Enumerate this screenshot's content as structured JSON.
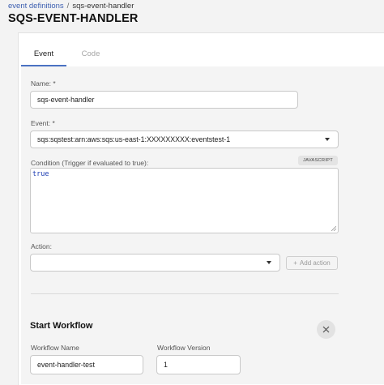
{
  "breadcrumb": {
    "link": "event definitions",
    "separator": "/",
    "current": "sqs-event-handler"
  },
  "page": {
    "title": "SQS-EVENT-HANDLER"
  },
  "tabs": [
    {
      "label": "Event",
      "active": true
    },
    {
      "label": "Code",
      "active": false
    }
  ],
  "form": {
    "name": {
      "label": "Name: *",
      "value": "sqs-event-handler"
    },
    "event": {
      "label": "Event: *",
      "value": "sqs:sqstest:arn:aws:sqs:us-east-1:XXXXXXXXX:eventstest-1"
    },
    "condition": {
      "label": "Condition (Trigger if evaluated to true):",
      "value": "true",
      "language_badge": "JAVASCRIPT"
    },
    "action": {
      "label": "Action:",
      "value": "",
      "add_label": "Add action"
    }
  },
  "start_workflow": {
    "title": "Start Workflow",
    "workflow_name": {
      "label": "Workflow Name",
      "value": "event-handler-test"
    },
    "workflow_version": {
      "label": "Workflow Version",
      "value": "1"
    }
  },
  "colors": {
    "accent": "#4a72c2",
    "link": "#3d5fb0",
    "code": "#1f3fb3"
  },
  "icons": [
    "chevron-down-icon",
    "plus-icon",
    "close-icon",
    "resize-grip-icon"
  ]
}
